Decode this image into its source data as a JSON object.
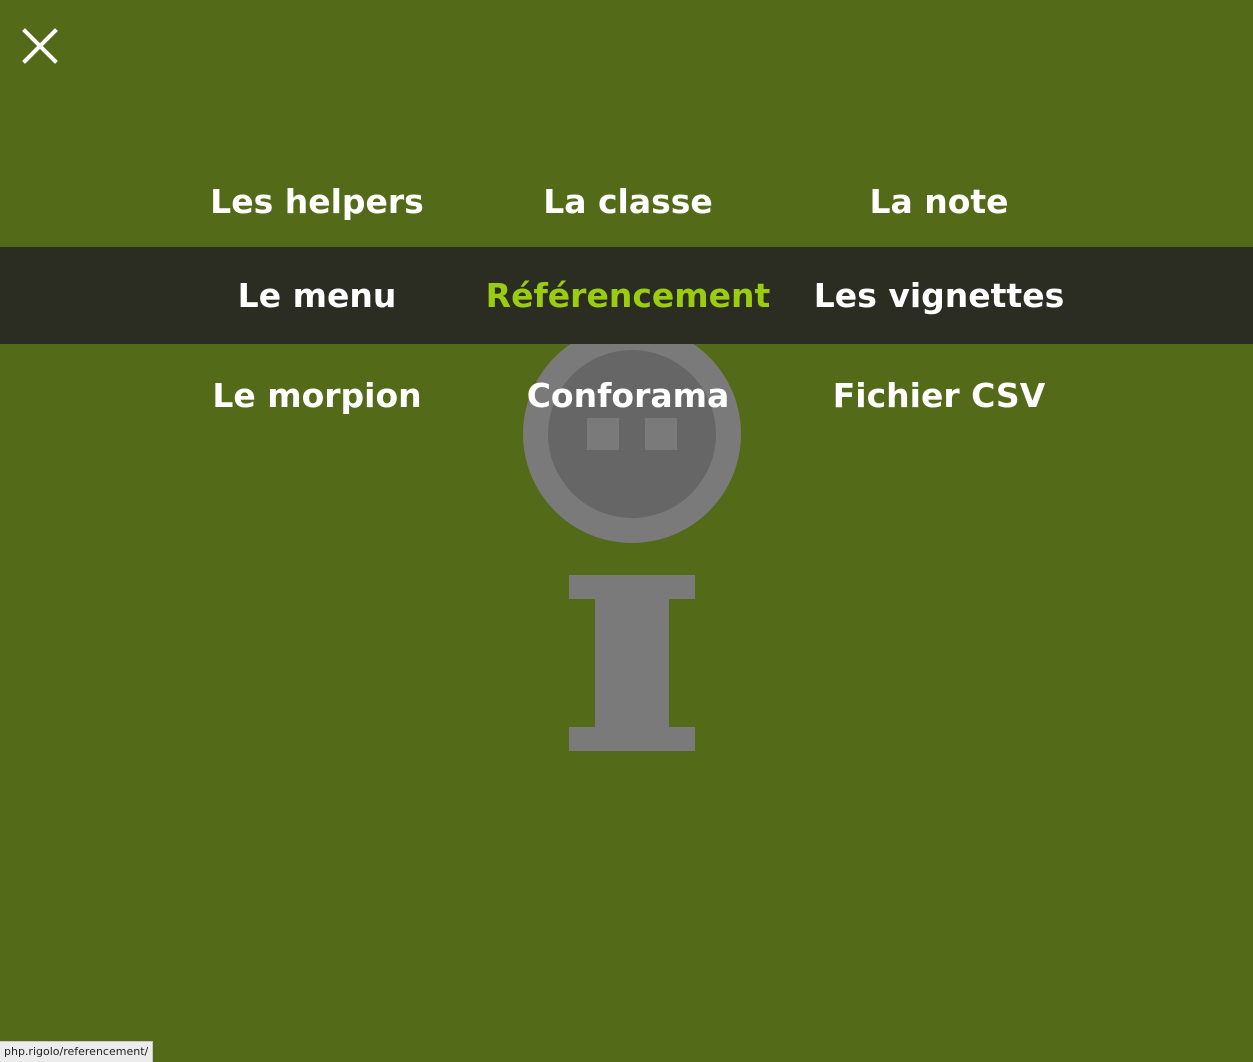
{
  "menu": {
    "close_icon": "close-x-icon",
    "rows": [
      {
        "items": [
          "Les helpers",
          "La classe",
          "La note"
        ]
      },
      {
        "items": [
          "Le menu",
          "Référencement",
          "Les vignettes"
        ]
      },
      {
        "items": [
          "Le morpion",
          "Conforama",
          "Fichier CSV"
        ]
      }
    ],
    "active_item": "Référencement"
  },
  "background_logo_icon": "info-mascot-logo-icon",
  "status_bar": {
    "url": "php.rigolo/referencement/"
  },
  "colors": {
    "background": "#536b18",
    "highlight_row": "#2b2c22",
    "active_text": "#9acd10",
    "text": "#ffffff",
    "logo": "#7a7a7a"
  }
}
